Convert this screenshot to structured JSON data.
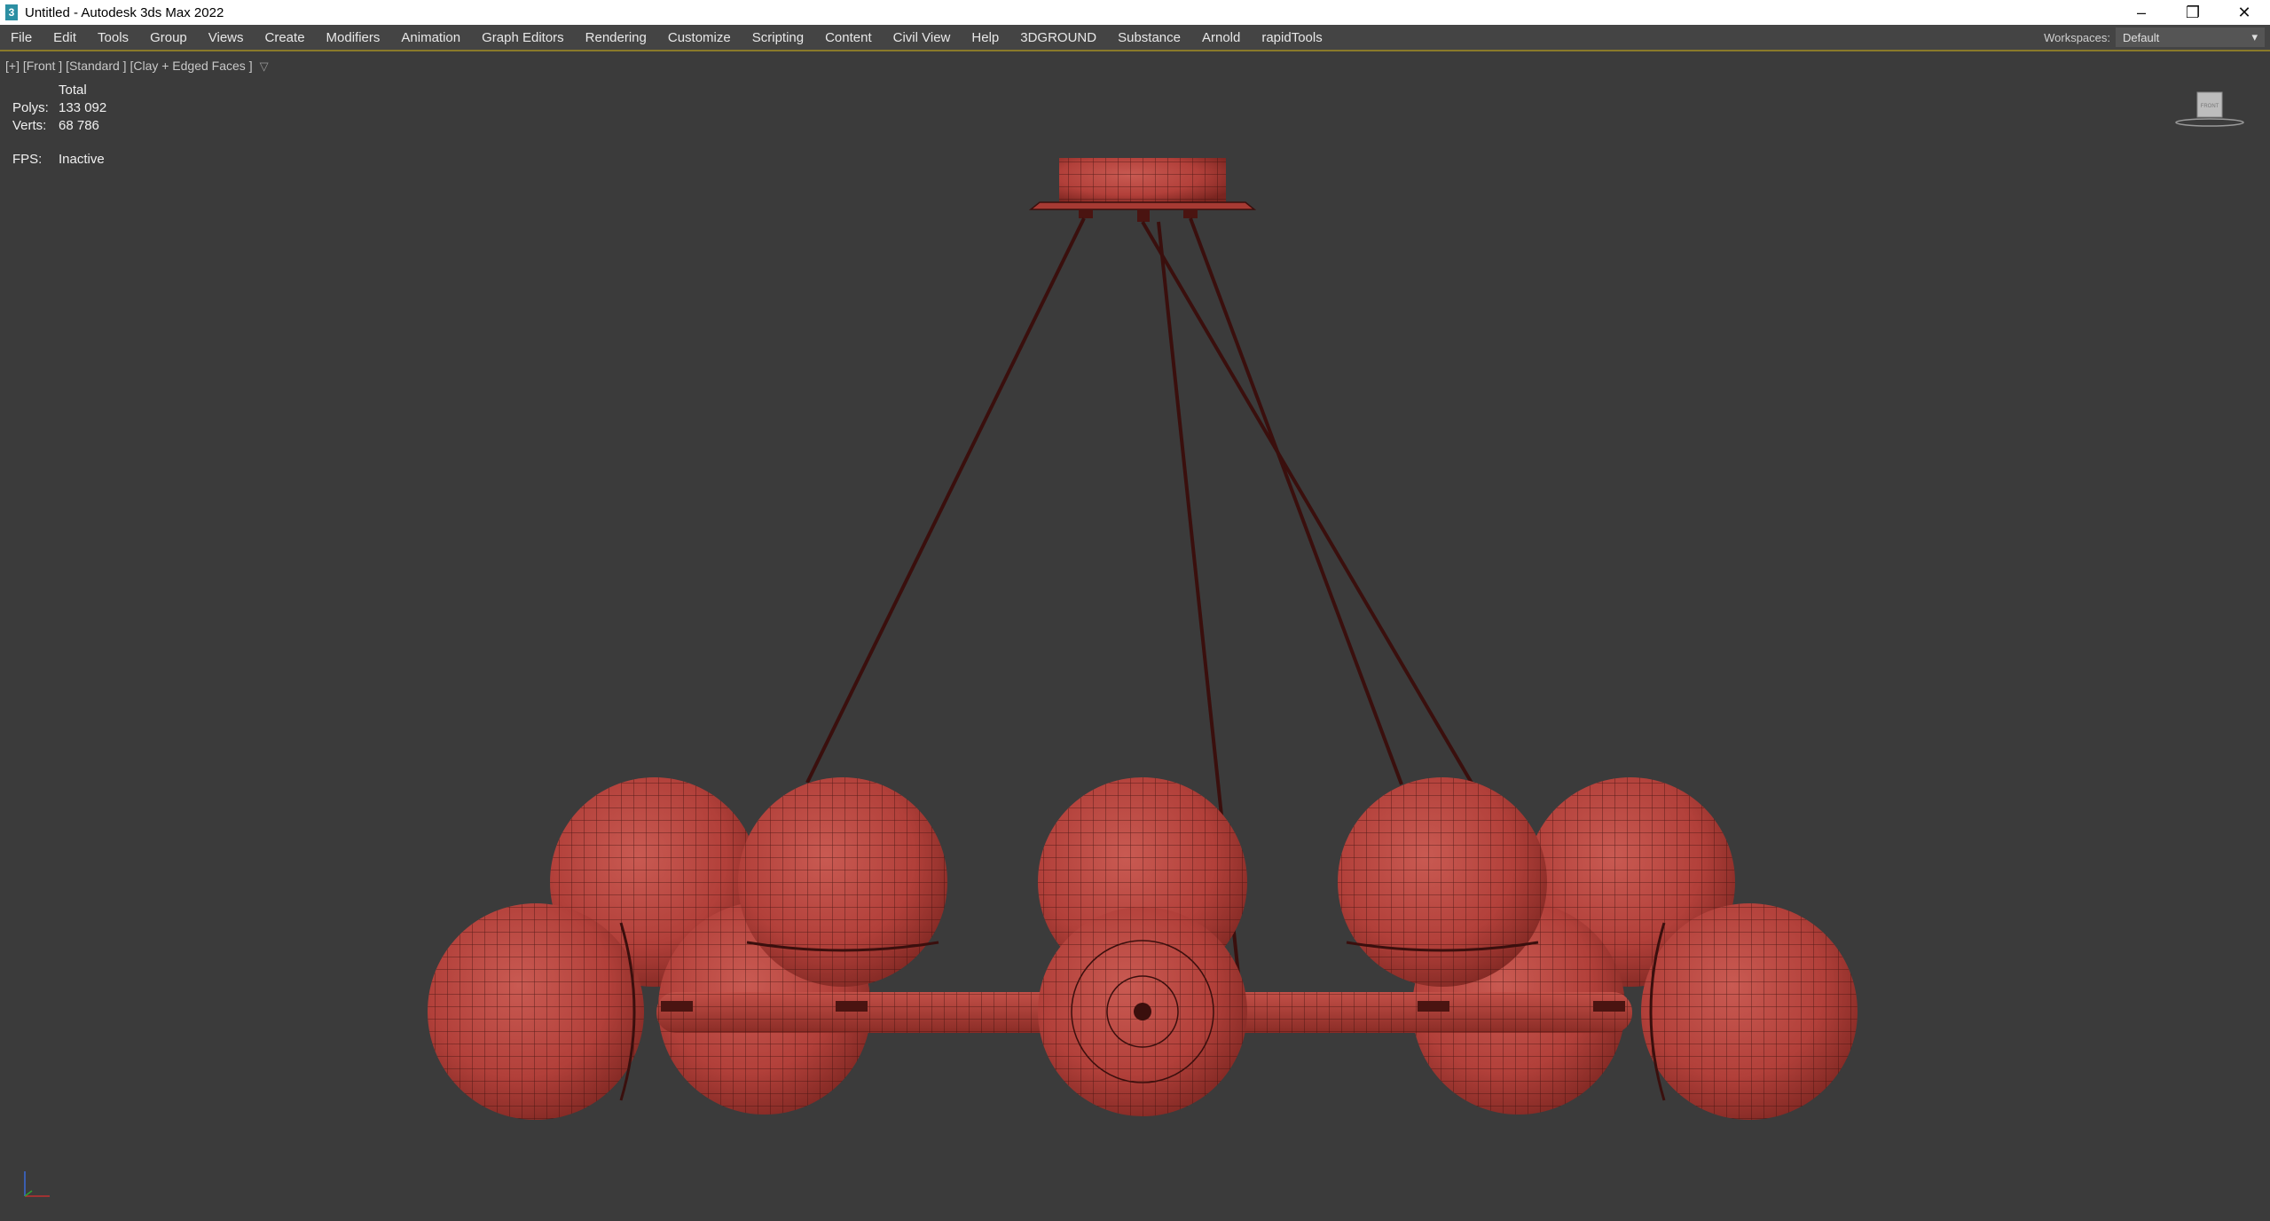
{
  "window": {
    "title": "Untitled - Autodesk 3ds Max 2022",
    "icon": "3"
  },
  "menu": [
    "File",
    "Edit",
    "Tools",
    "Group",
    "Views",
    "Create",
    "Modifiers",
    "Animation",
    "Graph Editors",
    "Rendering",
    "Customize",
    "Scripting",
    "Content",
    "Civil View",
    "Help",
    "3DGROUND",
    "Substance",
    "Arnold",
    "rapidTools"
  ],
  "workspaces": {
    "label": "Workspaces:",
    "value": "Default"
  },
  "viewport": {
    "label": "[+] [Front ] [Standard ] [Clay + Edged Faces ]",
    "stats": {
      "header": "Total",
      "polys_label": "Polys:",
      "polys_value": "133 092",
      "verts_label": "Verts:",
      "verts_value": "68 786",
      "fps_label": "FPS:",
      "fps_value": "Inactive"
    },
    "viewcube_face": "FRONT"
  },
  "colors": {
    "sphere": "#b8403a",
    "wire": "#3a0f0d",
    "viewport_bg": "#3b3b3b"
  }
}
